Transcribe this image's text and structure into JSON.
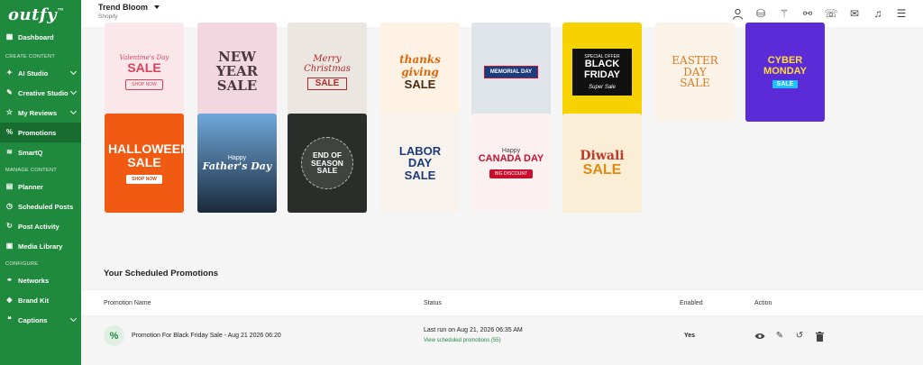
{
  "sidebar": {
    "logo": "outfy",
    "logo_mark": "™",
    "dashboard": {
      "label": "Dashboard",
      "icon": "dashboard-icon"
    },
    "section_create": "CREATE CONTENT",
    "ai_studio": {
      "label": "AI Studio",
      "icon": "ai-icon"
    },
    "creative_studio": {
      "label": "Creative Studio",
      "icon": "creative-icon"
    },
    "my_reviews": {
      "label": "My Reviews",
      "icon": "reviews-icon"
    },
    "promotions": {
      "label": "Promotions",
      "icon": "promotions-icon"
    },
    "smartq": {
      "label": "SmartQ",
      "icon": "smartq-icon"
    },
    "section_manage": "MANAGE CONTENT",
    "planner": {
      "label": "Planner",
      "icon": "planner-icon"
    },
    "scheduled_posts": {
      "label": "Scheduled Posts",
      "icon": "scheduled-icon"
    },
    "post_activity": {
      "label": "Post Activity",
      "icon": "activity-icon"
    },
    "media_library": {
      "label": "Media Library",
      "icon": "media-icon"
    },
    "section_configure": "CONFIGURE",
    "networks": {
      "label": "Networks",
      "icon": "networks-icon"
    },
    "brand_kit": {
      "label": "Brand Kit",
      "icon": "brandkit-icon"
    },
    "captions": {
      "label": "Captions",
      "icon": "captions-icon"
    }
  },
  "topbar": {
    "store_name": "Trend Bloom",
    "platform": "Shopify",
    "icons": [
      "user-icon",
      "coins-icon",
      "magic-wand-icon",
      "handshake-icon",
      "support-icon",
      "mail-icon",
      "notification-icon",
      "menu-icon"
    ]
  },
  "templates": {
    "valentines": {
      "l1": "Valentine's Day",
      "l2": "SALE",
      "btn": "SHOP NOW"
    },
    "new_year": {
      "l2": "NEW YEAR SALE"
    },
    "christmas": {
      "l1": "Merry Christmas",
      "l2": "SALE"
    },
    "thanksgiving": {
      "l1": "thanks giving",
      "l2": "SALE"
    },
    "memorial": {
      "l1": "MEMORIAL DAY"
    },
    "black_friday": {
      "l1": "SPECIAL OFFER",
      "l2": "BLACK FRIDAY",
      "l3": "Super Sale"
    },
    "easter": {
      "l2": "EASTER DAY SALE"
    },
    "cyber_monday": {
      "l2": "CYBER MONDAY",
      "l3": "SALE"
    },
    "halloween": {
      "l2": "HALLOWEEN SALE",
      "btn": "SHOP NOW"
    },
    "fathers_day": {
      "l1": "Happy",
      "l2": "Father's Day"
    },
    "end_season": {
      "l2": "END OF SEASON SALE"
    },
    "labor_day": {
      "l2": "LABOR DAY SALE"
    },
    "canada_day": {
      "l1": "Happy",
      "l2": "CANADA DAY",
      "btn": "BIG DISCOUNT"
    },
    "diwali": {
      "l1": "Diwali",
      "l2": "SALE"
    }
  },
  "scheduled": {
    "title": "Your Scheduled Promotions",
    "headers": {
      "name": "Promotion Name",
      "status": "Status",
      "enabled": "Enabled",
      "action": "Action"
    },
    "row": {
      "icon": "percent-icon",
      "name": "Promotion For Black Friday Sale - Aug 21 2026 06:20",
      "status": "Last run on Aug 21, 2026 06:35 AM",
      "link": "View scheduled promotions (55)",
      "enabled": "Yes",
      "actions": [
        "view-icon",
        "edit-icon",
        "restore-icon",
        "delete-icon"
      ]
    }
  }
}
